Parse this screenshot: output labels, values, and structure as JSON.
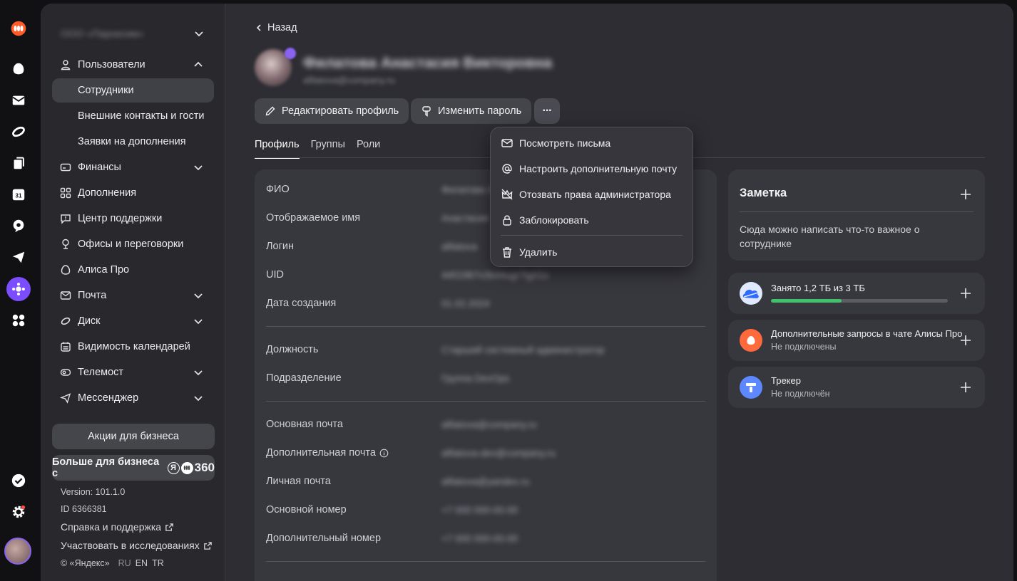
{
  "rail": {
    "icons": [
      "yandex-360-logo",
      "alice-icon",
      "mail-icon",
      "disk-icon",
      "docs-icon",
      "calendar-icon",
      "telemost-icon",
      "messenger-icon",
      "admin-icon",
      "apps-icon",
      "tasks-check-icon",
      "settings-icon",
      "user-avatar"
    ],
    "calendar_day": "31"
  },
  "sidebar": {
    "org_name": "ООО «Пароксим»",
    "items": [
      {
        "label": "Пользователи",
        "icon": "user-icon",
        "expandable": true,
        "expanded": true
      },
      {
        "label": "Сотрудники",
        "sub": true,
        "active": true
      },
      {
        "label": "Внешние контакты и гости",
        "sub": true
      },
      {
        "label": "Заявки на дополнения",
        "sub": true
      },
      {
        "label": "Финансы",
        "icon": "finance-icon",
        "expandable": true
      },
      {
        "label": "Дополнения",
        "icon": "addons-icon"
      },
      {
        "label": "Центр поддержки",
        "icon": "support-icon"
      },
      {
        "label": "Офисы и переговорки",
        "icon": "office-icon"
      },
      {
        "label": "Алиса Про",
        "icon": "alice-icon"
      },
      {
        "label": "Почта",
        "icon": "mail-icon",
        "expandable": true
      },
      {
        "label": "Диск",
        "icon": "disk-icon",
        "expandable": true
      },
      {
        "label": "Видимость календарей",
        "icon": "calendar-icon"
      },
      {
        "label": "Телемост",
        "icon": "telemost-icon",
        "expandable": true
      },
      {
        "label": "Мессенджер",
        "icon": "messenger-icon",
        "expandable": true
      }
    ],
    "promo_button": "Акции для бизнеса",
    "more_button": "Больше для бизнеса с",
    "more_button_logo": "360",
    "version": "Version: 101.1.0",
    "id": "ID 6366381",
    "help_link": "Справка и поддержка",
    "research_link": "Участвовать в исследованиях",
    "copyright": "© «Яндекс»",
    "langs": [
      "RU",
      "EN",
      "TR"
    ]
  },
  "main": {
    "back_label": "Назад",
    "user_name": "Филатова Анастасия Викторовна",
    "user_email": "afilatova@company.ru",
    "edit_button": "Редактировать профиль",
    "password_button": "Изменить пароль",
    "more_button": "···",
    "tabs": [
      "Профиль",
      "Группы",
      "Роли"
    ],
    "active_tab": "Профиль"
  },
  "profile": {
    "group1": [
      {
        "label": "ФИО",
        "value": "Филатова Анастасия"
      },
      {
        "label": "Отображаемое имя",
        "value": "Анастасия"
      },
      {
        "label": "Логин",
        "value": "afilatova"
      },
      {
        "label": "UID",
        "value": "4401967x3b44ugr7tgrt1s"
      },
      {
        "label": "Дата создания",
        "value": "01.02.2024"
      }
    ],
    "group2": [
      {
        "label": "Должность",
        "value": "Старший системный администратор"
      },
      {
        "label": "Подразделение",
        "value": "Группа DevOps"
      }
    ],
    "group3": [
      {
        "label": "Основная почта",
        "value": "afilatova@company.ru"
      },
      {
        "label": "Дополнительная почта",
        "value": "afilatova-dev@company.ru"
      },
      {
        "label": "Личная почта",
        "value": "afilatova@yandex.ru"
      },
      {
        "label": "Основной номер",
        "value": "+7 000 000-00-00"
      },
      {
        "label": "Дополнительный номер",
        "value": "+7 000 000-00-00"
      }
    ]
  },
  "note": {
    "title": "Заметка",
    "text": "Сюда можно написать что-то важное о сотруднике"
  },
  "services": [
    {
      "title": "Занято 1,2 ТБ из 3 ТБ",
      "progress": 0.4,
      "icon": "disk-cloud-icon"
    },
    {
      "title": "Дополнительные запросы в чате Алисы Про",
      "subtitle": "Не подключены",
      "icon": "alice-pro-icon"
    },
    {
      "title": "Трекер",
      "subtitle": "Не подключён",
      "icon": "tracker-icon"
    }
  ],
  "dropdown": {
    "items": [
      {
        "label": "Посмотреть письма",
        "icon": "envelope-icon"
      },
      {
        "label": "Настроить дополнительную почту",
        "icon": "at-icon"
      },
      {
        "label": "Отозвать права администратора",
        "icon": "crown-off-icon"
      },
      {
        "label": "Заблокировать",
        "icon": "lock-icon"
      },
      {
        "label": "Удалить",
        "icon": "trash-icon"
      }
    ]
  },
  "colors": {
    "accent_purple": "#7b4dff",
    "progress_green": "#3fc26b",
    "brand_orange": "#ff5a2a"
  }
}
